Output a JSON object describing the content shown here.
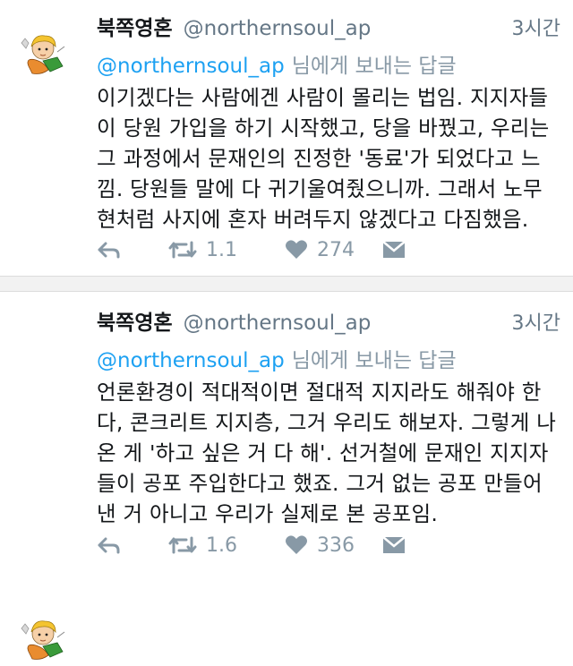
{
  "tweets": [
    {
      "author_name": "북쪽영혼",
      "handle": "@northernsoul_ap",
      "time": "3시간",
      "reply_mention": "@northernsoul_ap",
      "reply_suffix": "님에게 보내는 답글",
      "text": "이기겠다는 사람에겐 사람이 몰리는 법임. 지지자들이 당원 가입을 하기 시작했고, 당을 바꿨고, 우리는 그 과정에서 문재인의 진정한 '동료'가 되었다고 느낌. 당원들 말에 다 귀기울여줬으니까. 그래서 노무현처럼 사지에 혼자 버려두지 않겠다고 다짐했음.",
      "retweets": "1.1",
      "likes": "274"
    },
    {
      "author_name": "북쪽영혼",
      "handle": "@northernsoul_ap",
      "time": "3시간",
      "reply_mention": "@northernsoul_ap",
      "reply_suffix": "님에게 보내는 답글",
      "text": "언론환경이 적대적이면 절대적 지지라도 해줘야 한다, 콘크리트 지지층, 그거 우리도 해보자. 그렇게 나온 게 '하고 싶은 거 다 해'. 선거철에 문재인 지지자들이 공포 주입한다고 했죠. 그거 없는 공포 만들어낸 거 아니고 우리가 실제로 본 공포임.",
      "retweets": "1.6",
      "likes": "336"
    }
  ],
  "icons": [
    "reply-icon",
    "retweet-icon",
    "like-icon",
    "direct-message-icon"
  ],
  "colors": {
    "mention": "#1da1f2",
    "secondary_text": "#657786",
    "action_icon": "#8899a6",
    "separator": "#f2f2f2"
  }
}
